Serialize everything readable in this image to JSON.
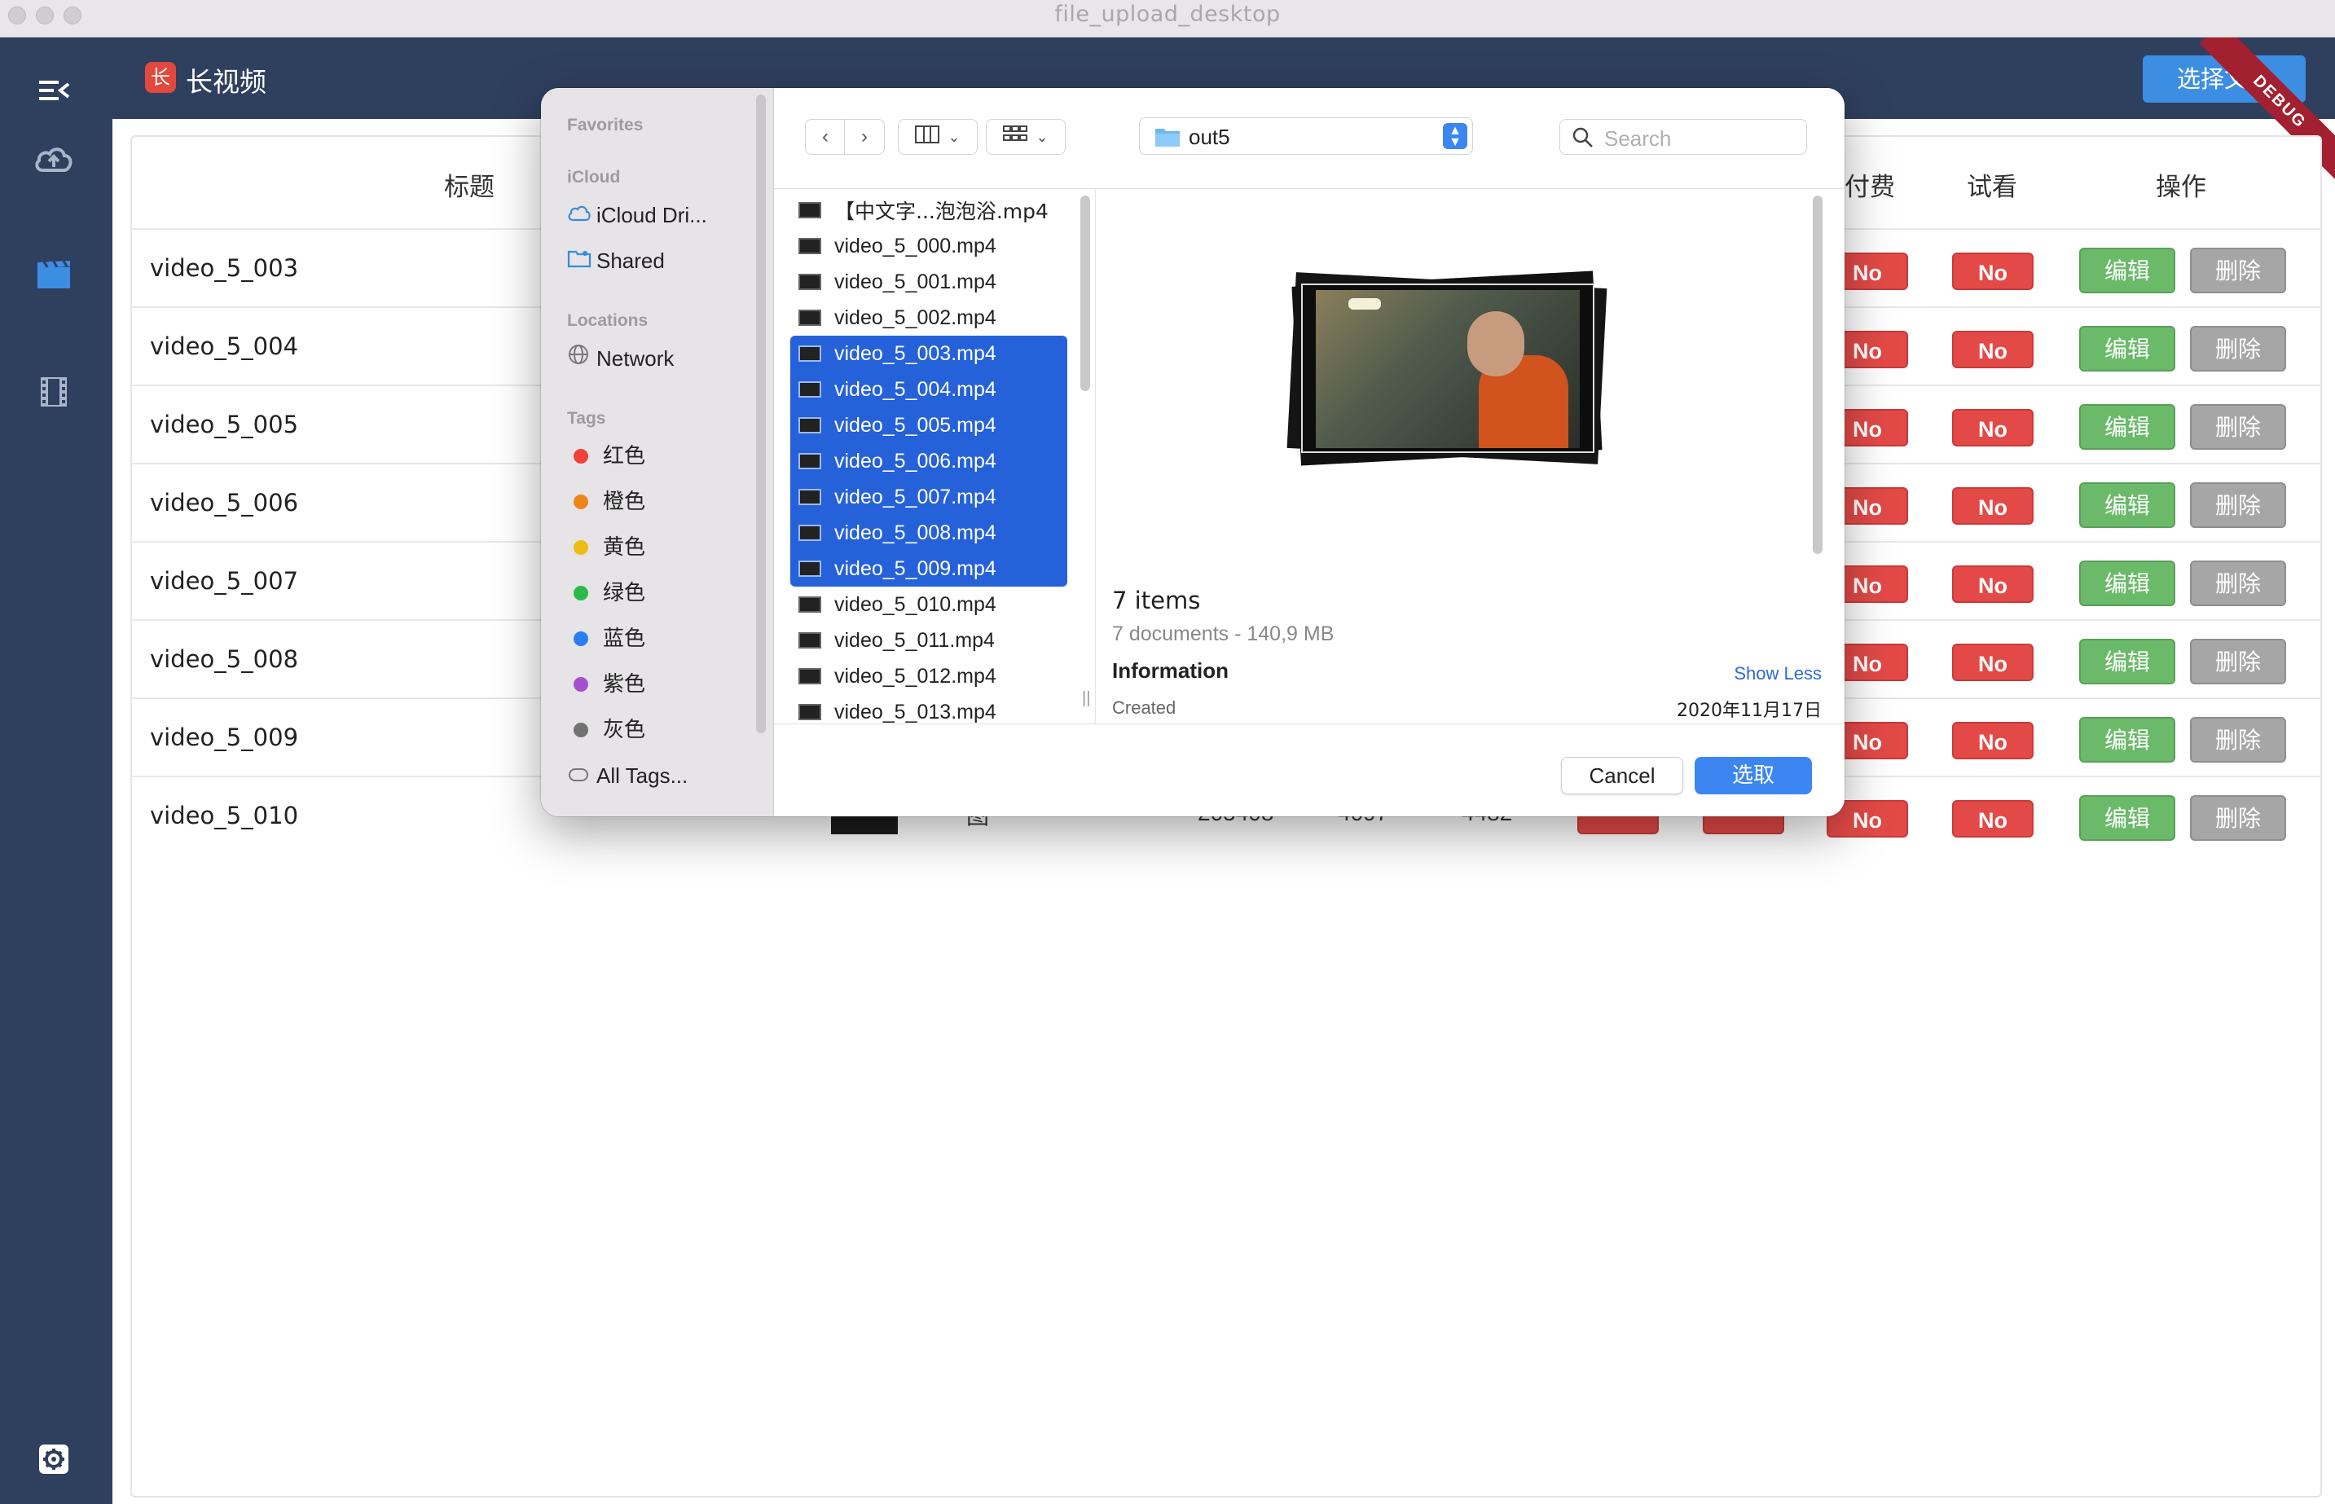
{
  "window": {
    "title": "file_upload_desktop"
  },
  "header": {
    "logo_char": "长",
    "app_name": "长视频",
    "select_button": "选择文件",
    "debug_ribbon": "DEBUG"
  },
  "table": {
    "headers": {
      "title": "标题",
      "paid": "付费",
      "preview": "试看",
      "actions": "操作"
    },
    "rows": [
      {
        "title": "video_5_003",
        "paid": "No",
        "preview": "No",
        "edit": "编辑",
        "delete": "删除"
      },
      {
        "title": "video_5_004",
        "paid": "No",
        "preview": "No",
        "edit": "编辑",
        "delete": "删除"
      },
      {
        "title": "video_5_005",
        "paid": "No",
        "preview": "No",
        "edit": "编辑",
        "delete": "删除"
      },
      {
        "title": "video_5_006",
        "paid": "No",
        "preview": "No",
        "edit": "编辑",
        "delete": "删除"
      },
      {
        "title": "video_5_007",
        "paid": "No",
        "preview": "No",
        "edit": "编辑",
        "delete": "删除"
      },
      {
        "title": "video_5_008",
        "paid": "No",
        "preview": "No",
        "edit": "编辑",
        "delete": "删除"
      },
      {
        "title": "video_5_009",
        "paid": "No",
        "preview": "No",
        "edit": "编辑",
        "delete": "删除"
      },
      {
        "title": "video_5_010",
        "paid": "No",
        "preview": "No",
        "edit": "编辑",
        "delete": "删除",
        "partial": [
          "图",
          "205408",
          "4097",
          "4482"
        ]
      }
    ]
  },
  "dialog": {
    "sidebar": {
      "favorites": "Favorites",
      "icloud": "iCloud",
      "icloud_drive": "iCloud Dri...",
      "shared": "Shared",
      "locations": "Locations",
      "network": "Network",
      "tags": "Tags",
      "tag_items": [
        {
          "label": "红色",
          "color": "#f0413a"
        },
        {
          "label": "橙色",
          "color": "#f0841a"
        },
        {
          "label": "黄色",
          "color": "#ecbc12"
        },
        {
          "label": "绿色",
          "color": "#2db84a"
        },
        {
          "label": "蓝色",
          "color": "#2a7ff0"
        },
        {
          "label": "紫色",
          "color": "#a44ed0"
        },
        {
          "label": "灰色",
          "color": "#727272"
        }
      ],
      "all_tags": "All Tags..."
    },
    "toolbar": {
      "location": "out5",
      "search_placeholder": "Search"
    },
    "files": [
      {
        "name": "【中文字...泡泡浴.mp4",
        "selected": false
      },
      {
        "name": "video_5_000.mp4",
        "selected": false
      },
      {
        "name": "video_5_001.mp4",
        "selected": false
      },
      {
        "name": "video_5_002.mp4",
        "selected": false
      },
      {
        "name": "video_5_003.mp4",
        "selected": true
      },
      {
        "name": "video_5_004.mp4",
        "selected": true
      },
      {
        "name": "video_5_005.mp4",
        "selected": true
      },
      {
        "name": "video_5_006.mp4",
        "selected": true
      },
      {
        "name": "video_5_007.mp4",
        "selected": true
      },
      {
        "name": "video_5_008.mp4",
        "selected": true
      },
      {
        "name": "video_5_009.mp4",
        "selected": true
      },
      {
        "name": "video_5_010.mp4",
        "selected": false
      },
      {
        "name": "video_5_011.mp4",
        "selected": false
      },
      {
        "name": "video_5_012.mp4",
        "selected": false
      },
      {
        "name": "video_5_013.mp4",
        "selected": false
      }
    ],
    "preview": {
      "count": "7 items",
      "summary": "7 documents - 140,9 MB",
      "info_label": "Information",
      "show_less": "Show Less",
      "created_label": "Created",
      "created_value": "2020年11月17日"
    },
    "cancel": "Cancel",
    "choose": "选取"
  },
  "colors": {
    "rail": "#2f3f5e",
    "accent_blue": "#3c8ee3",
    "badge_red": "#e34a47",
    "edit_green": "#6aba6a",
    "delete_gray": "#a6a6a6",
    "selection": "#2561d9"
  }
}
